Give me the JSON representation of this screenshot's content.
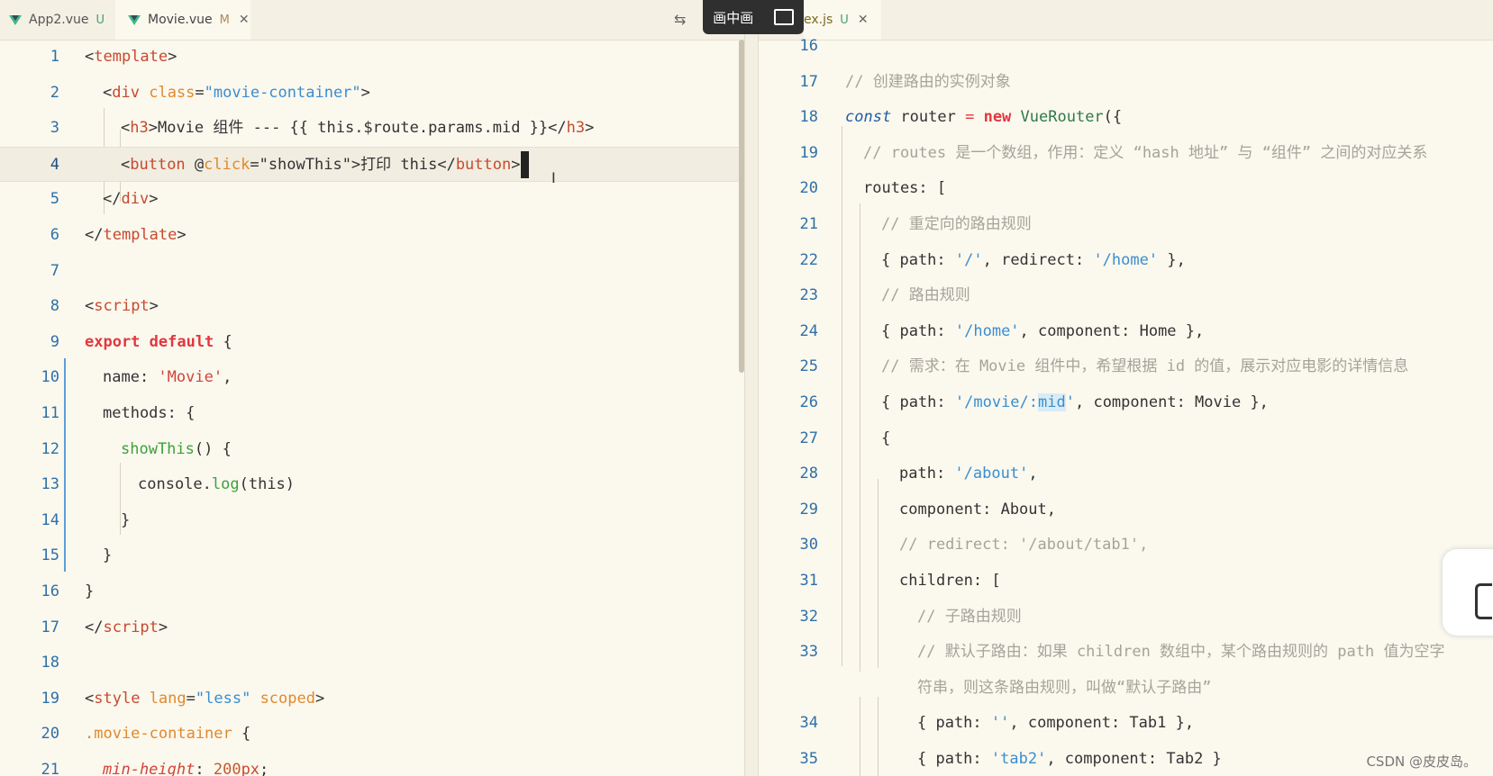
{
  "left": {
    "tabs": [
      {
        "name": "App2.vue",
        "flag": "U"
      },
      {
        "name": "Movie.vue",
        "flag": "M"
      }
    ],
    "lines": [
      {
        "n": "1",
        "parts": [
          [
            "tag",
            "<template"
          ],
          [
            "",
            "<"
          ],
          [
            "",
            ">"
          ]
        ]
      },
      {
        "n": "2"
      },
      {
        "n": "3"
      },
      {
        "n": "4"
      },
      {
        "n": "5"
      },
      {
        "n": "6"
      },
      {
        "n": "7"
      },
      {
        "n": "8"
      },
      {
        "n": "9"
      },
      {
        "n": "10"
      },
      {
        "n": "11"
      },
      {
        "n": "12"
      },
      {
        "n": "13"
      },
      {
        "n": "14"
      },
      {
        "n": "15"
      },
      {
        "n": "16"
      },
      {
        "n": "17"
      },
      {
        "n": "18"
      },
      {
        "n": "19"
      },
      {
        "n": "20"
      },
      {
        "n": "21"
      }
    ]
  },
  "right": {
    "tab": {
      "name": "ex.js",
      "flag": "U"
    }
  },
  "pip": {
    "label": "画中画"
  },
  "watermark": "CSDN @皮皮岛。",
  "ln": {
    "l1": "1",
    "l2": "2",
    "l3": "3",
    "l4": "4",
    "l5": "5",
    "l6": "6",
    "l7": "7",
    "l8": "8",
    "l9": "9",
    "l10": "10",
    "l11": "11",
    "l12": "12",
    "l13": "13",
    "l14": "14",
    "l15": "15",
    "l16": "16",
    "l17": "17",
    "l18": "18",
    "l19": "19",
    "l20": "20",
    "l21": "21",
    "r16": "16",
    "r17": "17",
    "r18": "18",
    "r19": "19",
    "r20": "20",
    "r21": "21",
    "r22": "22",
    "r23": "23",
    "r24": "24",
    "r25": "25",
    "r26": "26",
    "r27": "27",
    "r28": "28",
    "r29": "29",
    "r30": "30",
    "r31": "31",
    "r32": "32",
    "r33": "33",
    "r34": "34",
    "r35": "35"
  },
  "code": {
    "l1": [
      "<",
      "template",
      ">"
    ],
    "l2": [
      "<",
      "div",
      " ",
      "class",
      "=",
      "\"movie-container\"",
      ">"
    ],
    "l3": [
      "<",
      "h3",
      ">Movie 组件 --- {{ this.$route.params.mid }}</",
      "h3",
      ">"
    ],
    "l4": [
      "<",
      "button",
      " @",
      "click",
      "=\"showThis\">打印 this</",
      "button",
      ">"
    ],
    "l5": [
      "</",
      "div",
      ">"
    ],
    "l6": [
      "</",
      "template",
      ">"
    ],
    "l8": [
      "<",
      "script",
      ">"
    ],
    "l9": [
      "export default",
      " {"
    ],
    "l10": [
      "name: ",
      "'Movie'",
      ","
    ],
    "l11": [
      "methods: {"
    ],
    "l12": [
      "showThis",
      "() {"
    ],
    "l13": [
      "console.",
      "log",
      "(this)"
    ],
    "l14": [
      "}"
    ],
    "l15": [
      "}"
    ],
    "l16": [
      "}"
    ],
    "l17": [
      "</",
      "script",
      ">"
    ],
    "l19": [
      "<",
      "style",
      " ",
      "lang",
      "=",
      "\"less\"",
      " ",
      "scoped",
      ">"
    ],
    "l20": [
      ".movie-container",
      " {"
    ],
    "l21": [
      "min-height",
      ": ",
      "200",
      "px",
      ";"
    ],
    "r17": [
      "// 创建路由的实例对象"
    ],
    "r18": [
      "const",
      " router ",
      "=",
      " ",
      "new",
      " ",
      "VueRouter",
      "({"
    ],
    "r19": [
      "// routes 是一个数组，作用：定义 “hash 地址” 与 “组件” 之间的对应关系"
    ],
    "r20": [
      "routes: ["
    ],
    "r21": [
      "// 重定向的路由规则"
    ],
    "r22": [
      "{ path: ",
      "'/'",
      ", redirect: ",
      "'/home'",
      " },"
    ],
    "r23": [
      "// 路由规则"
    ],
    "r24": [
      "{ path: ",
      "'/home'",
      ", component: Home },"
    ],
    "r25": [
      "// 需求：在 Movie 组件中，希望根据 id 的值，展示对应电影的详情信息"
    ],
    "r26": [
      "{ path: ",
      "'/movie/:",
      "mid",
      "'",
      ", component: Movie },"
    ],
    "r27": [
      "{"
    ],
    "r28": [
      "path: ",
      "'/about'",
      ","
    ],
    "r29": [
      "component: About,"
    ],
    "r30": [
      "// redirect: '/about/tab1',"
    ],
    "r31": [
      "children: ["
    ],
    "r32": [
      "// 子路由规则"
    ],
    "r33": [
      "// 默认子路由：如果 children 数组中，某个路由规则的 path 值为空字"
    ],
    "r33b": [
      "符串，则这条路由规则，叫做“默认子路由”"
    ],
    "r34": [
      "{ path: ",
      "''",
      ", component: Tab1 },"
    ],
    "r35": [
      "{ path: ",
      "'tab2'",
      ", component: Tab2 }"
    ]
  }
}
